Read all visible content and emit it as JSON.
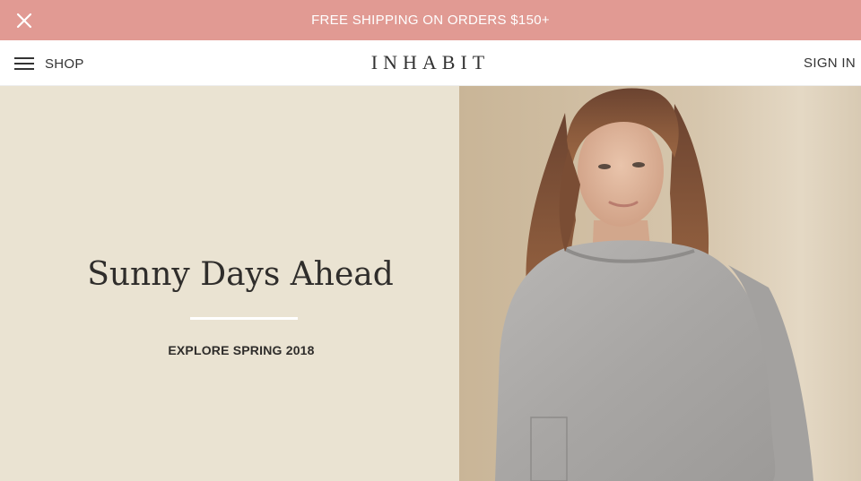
{
  "promo": {
    "text": "FREE SHIPPING ON ORDERS $150+",
    "close_icon": "close-icon"
  },
  "header": {
    "menu_icon": "hamburger-icon",
    "shop_label": "SHOP",
    "logo": "INHABIT",
    "sign_in_label": "SIGN IN"
  },
  "hero": {
    "title": "Sunny Days Ahead",
    "cta": "EXPLORE SPRING 2018",
    "image": "woman in grey sweater photo"
  },
  "colors": {
    "promo_bg": "#e19a93",
    "hero_left_bg": "#eae3d2",
    "text_dark": "#2f2d2b"
  }
}
